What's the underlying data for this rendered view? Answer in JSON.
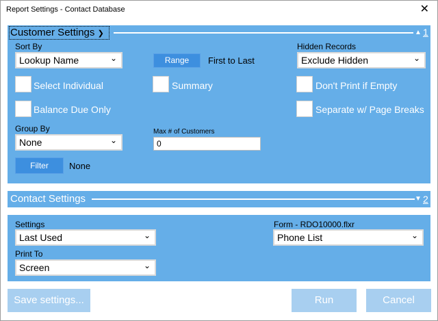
{
  "window": {
    "title": "Report Settings - Contact Database",
    "close_glyph": "✕"
  },
  "customer": {
    "title": "Customer Settings",
    "number": "1",
    "sort_by_label": "Sort By",
    "sort_by_value": "Lookup Name",
    "range_button": "Range",
    "range_value": "First to Last",
    "hidden_records_label": "Hidden Records",
    "hidden_records_value": "Exclude Hidden",
    "select_individual": "Select Individual",
    "summary": "Summary",
    "dont_print_if_empty": "Don't Print if Empty",
    "balance_due_only": "Balance Due Only",
    "separate_page_breaks": "Separate w/ Page Breaks",
    "group_by_label": "Group By",
    "group_by_value": "None",
    "max_customers_label": "Max # of Customers",
    "max_customers_value": "0",
    "filter_button": "Filter",
    "filter_value": "None"
  },
  "contact": {
    "title": "Contact Settings",
    "number": "2",
    "settings_label": "Settings",
    "settings_value": "Last Used",
    "form_label": "Form - RDO10000.flxr",
    "form_value": "Phone List",
    "print_to_label": "Print To",
    "print_to_value": "Screen"
  },
  "buttons": {
    "save_settings": "Save settings...",
    "run": "Run",
    "cancel": "Cancel"
  },
  "colors": {
    "panel": "#65aee8",
    "panel_light": "#8ec4ee",
    "button_blue": "#3d8fdf",
    "disabled_button": "#a8cff0"
  }
}
